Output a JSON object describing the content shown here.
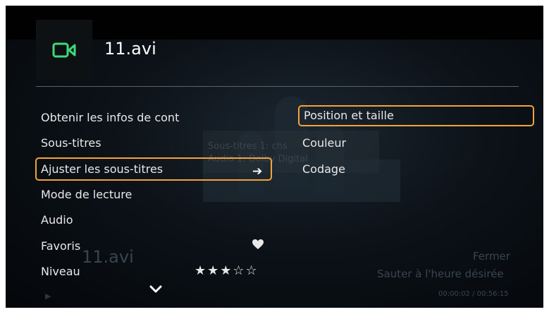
{
  "file": {
    "title": "11.avi"
  },
  "menu": {
    "items": [
      {
        "label": "Obtenir les infos de cont"
      },
      {
        "label": "Sous-titres"
      },
      {
        "label": "Ajuster les sous-titres"
      },
      {
        "label": "Mode de lecture"
      },
      {
        "label": "Audio"
      },
      {
        "label": "Favoris"
      },
      {
        "label": "Niveau"
      }
    ],
    "selected_index": 2,
    "rating": {
      "value": 3,
      "max": 5,
      "display": "★★★☆☆"
    }
  },
  "submenu": {
    "items": [
      {
        "label": "Position et taille"
      },
      {
        "label": "Couleur"
      },
      {
        "label": "Codage"
      }
    ],
    "selected_index": 0
  },
  "background": {
    "info_line1": "Sous-titres 1: chs",
    "info_line2": "Audio 1: Dolby Digital",
    "title": "11.avi",
    "close_label": "Fermer",
    "seek_label": "Sauter à l'heure désirée",
    "time": "00:00:02 / 00:56:15"
  },
  "colors": {
    "accent": "#f2a33a",
    "video_icon": "#3dd97b",
    "background": "#030405"
  },
  "icons": [
    "video-camera-icon",
    "arrow-right-icon",
    "heart-icon",
    "star-icon",
    "chevron-down-icon",
    "play-icon"
  ]
}
